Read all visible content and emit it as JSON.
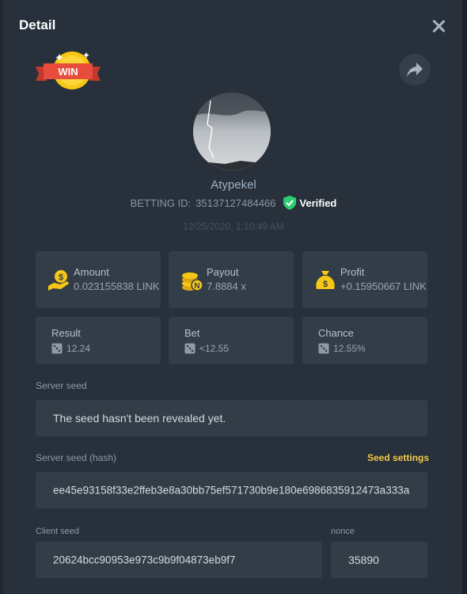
{
  "header": {
    "title": "Detail"
  },
  "badge": {
    "text": "WIN"
  },
  "player": {
    "username": "Atypekel",
    "betting_id_label": "BETTING ID:",
    "betting_id": "35137127484466",
    "verified_label": "Verified",
    "date": "12/25/2020, 1:10:49 AM"
  },
  "stats": [
    {
      "label": "Amount",
      "value": "0.023155838 LINK",
      "icon": "hand-coin-icon"
    },
    {
      "label": "Payout",
      "value": "7.8884 x",
      "icon": "coin-stack-icon"
    },
    {
      "label": "Profit",
      "value": "+0.15950667 LINK",
      "icon": "money-bag-icon"
    }
  ],
  "results": [
    {
      "label": "Result",
      "value": "12.24",
      "icon": "dice-icon"
    },
    {
      "label": "Bet",
      "value": "<12.55",
      "icon": "dice-icon"
    },
    {
      "label": "Chance",
      "value": "12.55%",
      "icon": "dice-icon"
    }
  ],
  "server_seed": {
    "label": "Server seed",
    "value": "The seed hasn't been revealed yet."
  },
  "server_seed_hash": {
    "label": "Server seed (hash)",
    "settings_label": "Seed settings",
    "value": "ee45e93158f33e2ffeb3e8a30bb75ef571730b9e180e6986835912473a333a"
  },
  "client_seed": {
    "label": "Client seed",
    "value": "20624bcc90953e973c9b9f04873eb9f7"
  },
  "nonce": {
    "label": "nonce",
    "value": "35890"
  },
  "colors": {
    "background": "#27303b",
    "card": "#333d48",
    "accent_yellow": "#f2c94c",
    "verified_green": "#2ecc71"
  }
}
